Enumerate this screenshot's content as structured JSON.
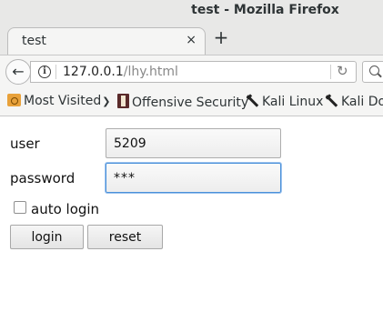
{
  "window": {
    "title": "test - Mozilla Firefox"
  },
  "tabs": [
    {
      "label": "test",
      "close_icon": "×"
    }
  ],
  "new_tab_icon": "+",
  "navbar": {
    "url_host": "127.0.0.1",
    "url_path": "/lhy.html"
  },
  "bookmarks": [
    {
      "label": "Most Visited",
      "icon": "folder-icon",
      "has_dropdown": true
    },
    {
      "label": "Offensive Security",
      "icon": "offsec-icon"
    },
    {
      "label": "Kali Linux",
      "icon": "kali-dragon-icon"
    },
    {
      "label": "Kali Do",
      "icon": "kali-dragon-icon"
    }
  ],
  "form": {
    "user_label": "user",
    "user_value": "5209",
    "password_label": "password",
    "password_value": "***",
    "auto_login_label": "auto login",
    "auto_login_checked": false,
    "login_button": "login",
    "reset_button": "reset"
  },
  "colors": {
    "chrome_bg": "#e8e8e7",
    "toolbar_bg": "#f5f5f4",
    "focus_ring": "#4a90d9"
  }
}
